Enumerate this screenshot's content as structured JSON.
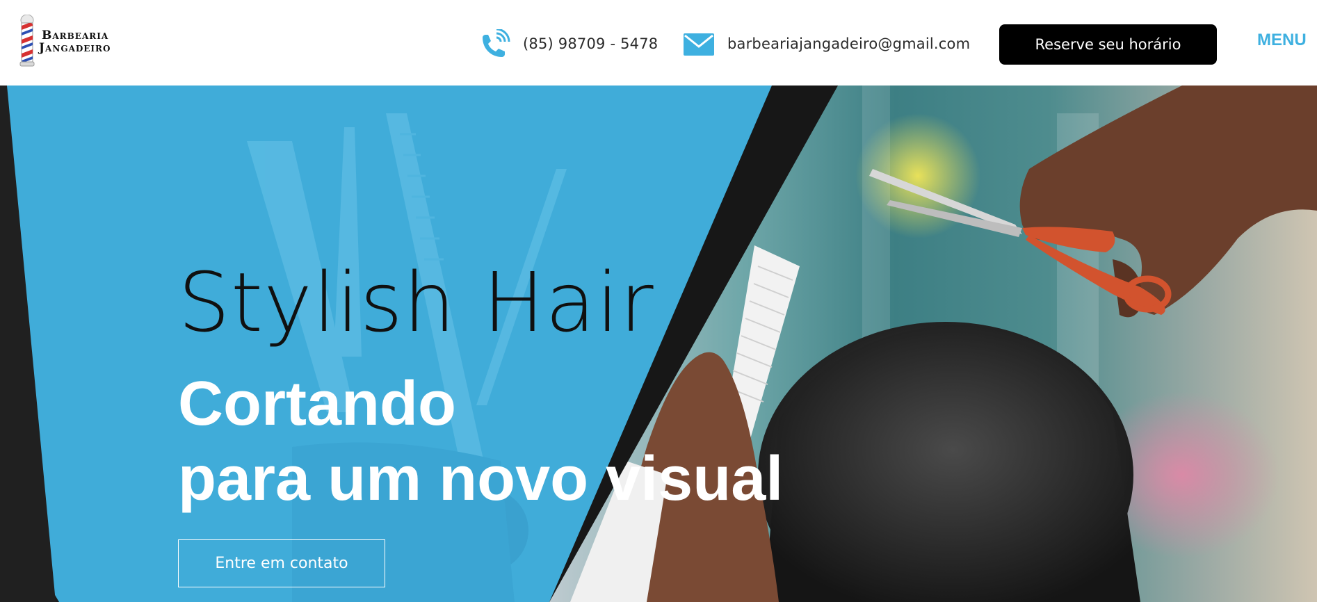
{
  "header": {
    "logo": {
      "line1": "Barbearia",
      "line2": "Jangadeiro"
    },
    "phone": {
      "icon": "phone-icon",
      "text": "(85) 98709 - 5478"
    },
    "email": {
      "icon": "mail-icon",
      "text": "barbeariajangadeiro@gmail.com"
    },
    "reserve_label": "Reserve seu horário",
    "menu_label": "MENU"
  },
  "hero": {
    "title": "Stylish Hair",
    "line1": "Cortando",
    "line2": "para um novo visual",
    "cta_label": "Entre em contato"
  },
  "colors": {
    "accent": "#3eb0e0",
    "hero_blue": "#40acd9",
    "button_dark": "#000000"
  }
}
